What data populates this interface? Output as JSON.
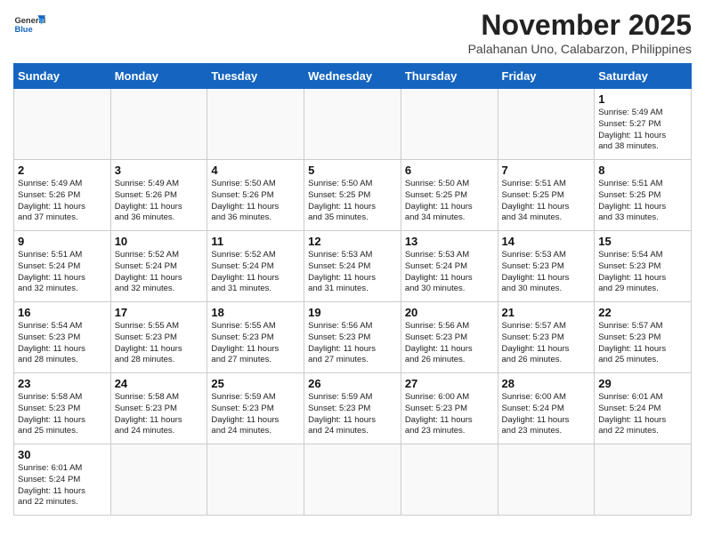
{
  "header": {
    "logo_general": "General",
    "logo_blue": "Blue",
    "month_title": "November 2025",
    "location": "Palahanan Uno, Calabarzon, Philippines"
  },
  "weekdays": [
    "Sunday",
    "Monday",
    "Tuesday",
    "Wednesday",
    "Thursday",
    "Friday",
    "Saturday"
  ],
  "weeks": [
    [
      {
        "day": "",
        "info": ""
      },
      {
        "day": "",
        "info": ""
      },
      {
        "day": "",
        "info": ""
      },
      {
        "day": "",
        "info": ""
      },
      {
        "day": "",
        "info": ""
      },
      {
        "day": "",
        "info": ""
      },
      {
        "day": "1",
        "info": "Sunrise: 5:49 AM\nSunset: 5:27 PM\nDaylight: 11 hours\nand 38 minutes."
      }
    ],
    [
      {
        "day": "2",
        "info": "Sunrise: 5:49 AM\nSunset: 5:26 PM\nDaylight: 11 hours\nand 37 minutes."
      },
      {
        "day": "3",
        "info": "Sunrise: 5:49 AM\nSunset: 5:26 PM\nDaylight: 11 hours\nand 36 minutes."
      },
      {
        "day": "4",
        "info": "Sunrise: 5:50 AM\nSunset: 5:26 PM\nDaylight: 11 hours\nand 36 minutes."
      },
      {
        "day": "5",
        "info": "Sunrise: 5:50 AM\nSunset: 5:25 PM\nDaylight: 11 hours\nand 35 minutes."
      },
      {
        "day": "6",
        "info": "Sunrise: 5:50 AM\nSunset: 5:25 PM\nDaylight: 11 hours\nand 34 minutes."
      },
      {
        "day": "7",
        "info": "Sunrise: 5:51 AM\nSunset: 5:25 PM\nDaylight: 11 hours\nand 34 minutes."
      },
      {
        "day": "8",
        "info": "Sunrise: 5:51 AM\nSunset: 5:25 PM\nDaylight: 11 hours\nand 33 minutes."
      }
    ],
    [
      {
        "day": "9",
        "info": "Sunrise: 5:51 AM\nSunset: 5:24 PM\nDaylight: 11 hours\nand 32 minutes."
      },
      {
        "day": "10",
        "info": "Sunrise: 5:52 AM\nSunset: 5:24 PM\nDaylight: 11 hours\nand 32 minutes."
      },
      {
        "day": "11",
        "info": "Sunrise: 5:52 AM\nSunset: 5:24 PM\nDaylight: 11 hours\nand 31 minutes."
      },
      {
        "day": "12",
        "info": "Sunrise: 5:53 AM\nSunset: 5:24 PM\nDaylight: 11 hours\nand 31 minutes."
      },
      {
        "day": "13",
        "info": "Sunrise: 5:53 AM\nSunset: 5:24 PM\nDaylight: 11 hours\nand 30 minutes."
      },
      {
        "day": "14",
        "info": "Sunrise: 5:53 AM\nSunset: 5:23 PM\nDaylight: 11 hours\nand 30 minutes."
      },
      {
        "day": "15",
        "info": "Sunrise: 5:54 AM\nSunset: 5:23 PM\nDaylight: 11 hours\nand 29 minutes."
      }
    ],
    [
      {
        "day": "16",
        "info": "Sunrise: 5:54 AM\nSunset: 5:23 PM\nDaylight: 11 hours\nand 28 minutes."
      },
      {
        "day": "17",
        "info": "Sunrise: 5:55 AM\nSunset: 5:23 PM\nDaylight: 11 hours\nand 28 minutes."
      },
      {
        "day": "18",
        "info": "Sunrise: 5:55 AM\nSunset: 5:23 PM\nDaylight: 11 hours\nand 27 minutes."
      },
      {
        "day": "19",
        "info": "Sunrise: 5:56 AM\nSunset: 5:23 PM\nDaylight: 11 hours\nand 27 minutes."
      },
      {
        "day": "20",
        "info": "Sunrise: 5:56 AM\nSunset: 5:23 PM\nDaylight: 11 hours\nand 26 minutes."
      },
      {
        "day": "21",
        "info": "Sunrise: 5:57 AM\nSunset: 5:23 PM\nDaylight: 11 hours\nand 26 minutes."
      },
      {
        "day": "22",
        "info": "Sunrise: 5:57 AM\nSunset: 5:23 PM\nDaylight: 11 hours\nand 25 minutes."
      }
    ],
    [
      {
        "day": "23",
        "info": "Sunrise: 5:58 AM\nSunset: 5:23 PM\nDaylight: 11 hours\nand 25 minutes."
      },
      {
        "day": "24",
        "info": "Sunrise: 5:58 AM\nSunset: 5:23 PM\nDaylight: 11 hours\nand 24 minutes."
      },
      {
        "day": "25",
        "info": "Sunrise: 5:59 AM\nSunset: 5:23 PM\nDaylight: 11 hours\nand 24 minutes."
      },
      {
        "day": "26",
        "info": "Sunrise: 5:59 AM\nSunset: 5:23 PM\nDaylight: 11 hours\nand 24 minutes."
      },
      {
        "day": "27",
        "info": "Sunrise: 6:00 AM\nSunset: 5:23 PM\nDaylight: 11 hours\nand 23 minutes."
      },
      {
        "day": "28",
        "info": "Sunrise: 6:00 AM\nSunset: 5:24 PM\nDaylight: 11 hours\nand 23 minutes."
      },
      {
        "day": "29",
        "info": "Sunrise: 6:01 AM\nSunset: 5:24 PM\nDaylight: 11 hours\nand 22 minutes."
      }
    ],
    [
      {
        "day": "30",
        "info": "Sunrise: 6:01 AM\nSunset: 5:24 PM\nDaylight: 11 hours\nand 22 minutes."
      },
      {
        "day": "",
        "info": ""
      },
      {
        "day": "",
        "info": ""
      },
      {
        "day": "",
        "info": ""
      },
      {
        "day": "",
        "info": ""
      },
      {
        "day": "",
        "info": ""
      },
      {
        "day": "",
        "info": ""
      }
    ]
  ]
}
